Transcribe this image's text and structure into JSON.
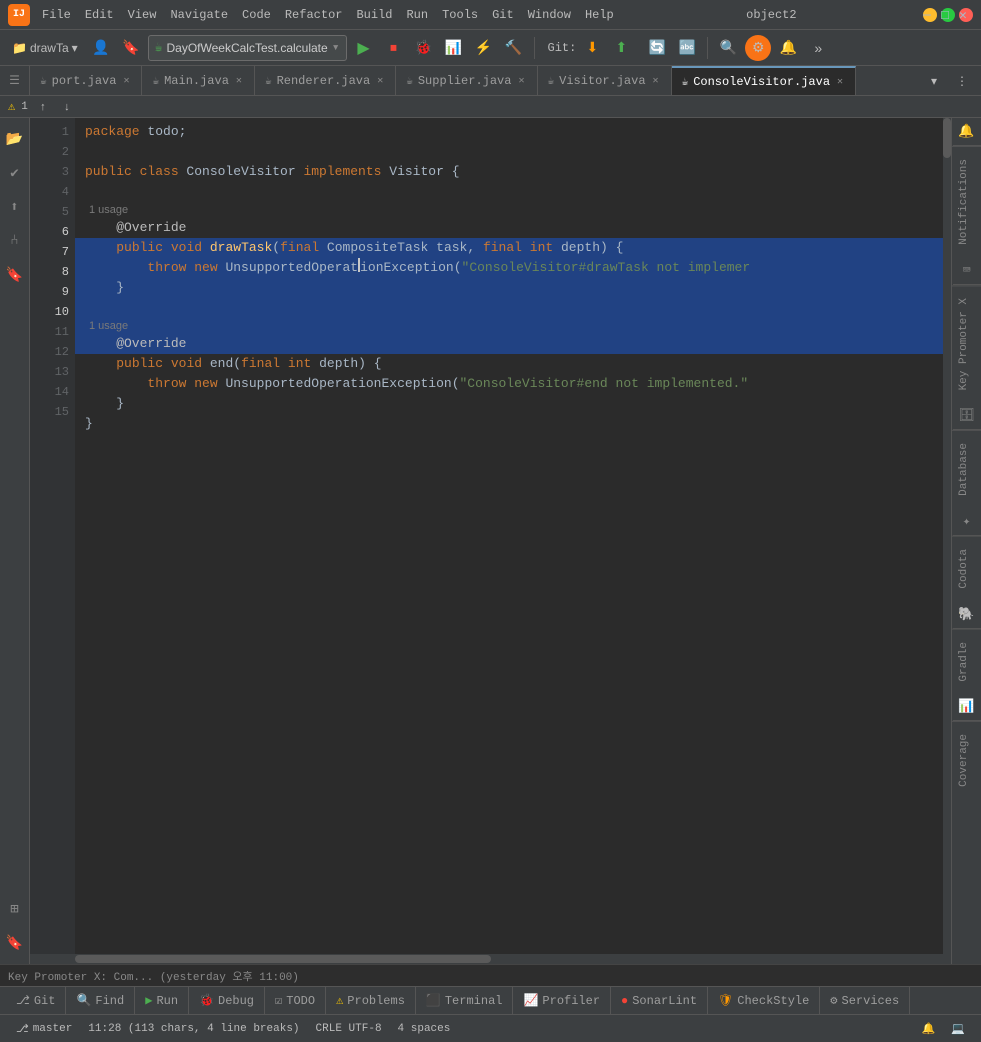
{
  "titleBar": {
    "appName": "object2",
    "menuItems": [
      "File",
      "Edit",
      "View",
      "Navigate",
      "Code",
      "Refactor",
      "Build",
      "Run",
      "Tools",
      "Git",
      "Window",
      "Help"
    ]
  },
  "toolbar": {
    "projectName": "drawTa",
    "runConfig": "DayOfWeekCalcTest.calculate",
    "gitLabel": "Git:"
  },
  "tabs": [
    {
      "label": "port.java",
      "icon": "☕",
      "active": false
    },
    {
      "label": "Main.java",
      "icon": "☕",
      "active": false
    },
    {
      "label": "Renderer.java",
      "icon": "☕",
      "active": false
    },
    {
      "label": "Supplier.java",
      "icon": "☕",
      "active": false
    },
    {
      "label": "Visitor.java",
      "icon": "☕",
      "active": false
    },
    {
      "label": "ConsoleVisitor.java",
      "icon": "☕",
      "active": true
    }
  ],
  "warningBar": {
    "icon": "⚠",
    "text": "1",
    "arrows": [
      "↑",
      "↓"
    ]
  },
  "code": {
    "lines": [
      {
        "num": 1,
        "content": "package todo;",
        "tokens": [
          {
            "text": "package ",
            "cls": "kw"
          },
          {
            "text": "todo",
            "cls": ""
          },
          {
            "text": ";",
            "cls": ""
          }
        ]
      },
      {
        "num": 2,
        "content": "",
        "tokens": []
      },
      {
        "num": 3,
        "content": "public class ConsoleVisitor implements Visitor {",
        "tokens": [
          {
            "text": "public ",
            "cls": "kw"
          },
          {
            "text": "class ",
            "cls": "kw"
          },
          {
            "text": "ConsoleVisitor ",
            "cls": ""
          },
          {
            "text": "implements ",
            "cls": "kw"
          },
          {
            "text": "Visitor",
            "cls": ""
          },
          {
            "text": " {",
            "cls": ""
          }
        ]
      },
      {
        "num": 4,
        "content": "",
        "tokens": []
      },
      {
        "num": 5,
        "content": "    @Override",
        "selected": false,
        "usage": "1 usage",
        "tokens": [
          {
            "text": "    @Override",
            "cls": "annotation"
          }
        ]
      },
      {
        "num": 6,
        "content": "    public void drawTask(final CompositeTask task, final int depth) {",
        "selected": true,
        "tokens": [
          {
            "text": "    ",
            "cls": ""
          },
          {
            "text": "public",
            "cls": "kw"
          },
          {
            "text": " ",
            "cls": ""
          },
          {
            "text": "void",
            "cls": "kw"
          },
          {
            "text": " ",
            "cls": ""
          },
          {
            "text": "drawTask",
            "cls": "method-name"
          },
          {
            "text": "(",
            "cls": ""
          },
          {
            "text": "final",
            "cls": "kw"
          },
          {
            "text": " ",
            "cls": ""
          },
          {
            "text": "CompositeTask",
            "cls": ""
          },
          {
            "text": " task, ",
            "cls": ""
          },
          {
            "text": "final",
            "cls": "kw"
          },
          {
            "text": " ",
            "cls": ""
          },
          {
            "text": "int",
            "cls": "kw"
          },
          {
            "text": " depth) {",
            "cls": ""
          }
        ]
      },
      {
        "num": 7,
        "content": "        throw new UnsupportedOperationException(\"ConsoleVisitor#drawTask not implemer",
        "selected": true,
        "cursor": true,
        "tokens": [
          {
            "text": "        ",
            "cls": ""
          },
          {
            "text": "throw",
            "cls": "kw"
          },
          {
            "text": " ",
            "cls": ""
          },
          {
            "text": "new",
            "cls": "kw"
          },
          {
            "text": " ",
            "cls": ""
          },
          {
            "text": "UnsupportedOperationException(",
            "cls": ""
          },
          {
            "text": "\"ConsoleVisitor#drawTask not implemer",
            "cls": "str"
          }
        ]
      },
      {
        "num": 8,
        "content": "    }",
        "selected": true,
        "tokens": [
          {
            "text": "    }",
            "cls": ""
          }
        ]
      },
      {
        "num": 9,
        "content": "",
        "selected": true,
        "tokens": []
      },
      {
        "num": 10,
        "content": "    @Override",
        "selected": true,
        "usage": "1 usage",
        "tokens": [
          {
            "text": "    @Override",
            "cls": "annotation"
          }
        ]
      },
      {
        "num": 11,
        "content": "    public void end(final int depth) {",
        "selected": false,
        "tokens": [
          {
            "text": "    ",
            "cls": ""
          },
          {
            "text": "public",
            "cls": "kw"
          },
          {
            "text": " ",
            "cls": ""
          },
          {
            "text": "void",
            "cls": "kw"
          },
          {
            "text": " end(",
            "cls": ""
          },
          {
            "text": "final",
            "cls": "kw"
          },
          {
            "text": " ",
            "cls": ""
          },
          {
            "text": "int",
            "cls": "kw"
          },
          {
            "text": " depth) {",
            "cls": ""
          }
        ]
      },
      {
        "num": 12,
        "content": "        throw new UnsupportedOperationException(\"ConsoleVisitor#end not implemented.\"",
        "tokens": [
          {
            "text": "        ",
            "cls": ""
          },
          {
            "text": "throw",
            "cls": "kw"
          },
          {
            "text": " ",
            "cls": ""
          },
          {
            "text": "new",
            "cls": "kw"
          },
          {
            "text": " ",
            "cls": ""
          },
          {
            "text": "UnsupportedOperationException(",
            "cls": ""
          },
          {
            "text": "\"ConsoleVisitor#end not implemented.\"",
            "cls": "str"
          }
        ]
      },
      {
        "num": 13,
        "content": "    }",
        "tokens": [
          {
            "text": "    }",
            "cls": ""
          }
        ]
      },
      {
        "num": 14,
        "content": "}",
        "tokens": [
          {
            "text": "}",
            "cls": ""
          }
        ]
      },
      {
        "num": 15,
        "content": "",
        "tokens": []
      }
    ]
  },
  "rightPanels": [
    {
      "label": "Notifications",
      "icon": "🔔"
    },
    {
      "label": "Key Promoter X",
      "icon": "⌨"
    },
    {
      "label": "Database",
      "icon": "🗄"
    },
    {
      "label": "Codota",
      "icon": "✦"
    },
    {
      "label": "Gradle",
      "icon": "🐘"
    },
    {
      "label": "Coverage",
      "icon": "📊"
    }
  ],
  "bottomTabs": [
    {
      "label": "Git",
      "icon": "⎇"
    },
    {
      "label": "Find",
      "icon": "🔍"
    },
    {
      "label": "Run",
      "icon": "▶"
    },
    {
      "label": "Debug",
      "icon": "🐞"
    },
    {
      "label": "TODO",
      "icon": "☑"
    },
    {
      "label": "Problems",
      "icon": "⚠"
    },
    {
      "label": "Terminal",
      "icon": ">_"
    },
    {
      "label": "Profiler",
      "icon": "📈"
    },
    {
      "label": "SonarLint",
      "icon": "🔴"
    },
    {
      "label": "CheckStyle",
      "icon": "✅"
    },
    {
      "label": "Services",
      "icon": "⚙"
    }
  ],
  "statusBar": {
    "keyPromoterText": "Key Promoter X: Com... (yesterday 오후 11:00)",
    "position": "11:28 (113 chars, 4 line breaks)",
    "encoding": "CRLE UTF-8",
    "indent": "4 spaces",
    "branch": "master",
    "memoryText": ""
  }
}
